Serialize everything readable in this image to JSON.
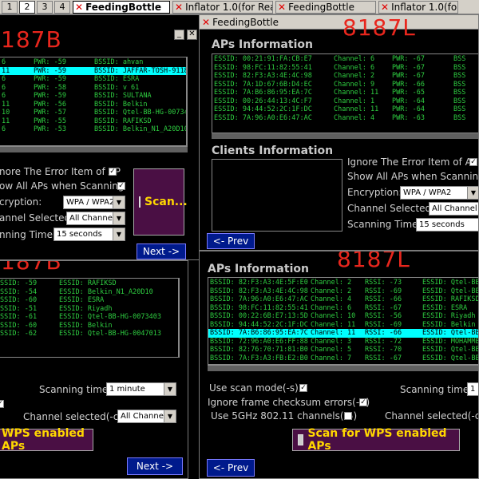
{
  "taskbar": {
    "workspaces": [
      "1",
      "2",
      "3",
      "4"
    ],
    "tasks": [
      "FeedingBottle",
      "Inflator 1.0(for Rea...",
      "FeedingBottle",
      "Inflator 1.0(for Rea..."
    ]
  },
  "win_tl": {
    "label": "187B",
    "rows": [
      {
        "essid": "6",
        "pwr": "PWR: -59",
        "bssid": "BSSID: ahvan"
      },
      {
        "essid": "11",
        "pwr": "PWR: -59",
        "bssid": "BSSID: JAFFAR-TOSH-91180"
      },
      {
        "essid": "6",
        "pwr": "PWR: -59",
        "bssid": "BSSID: ESRA"
      },
      {
        "essid": "6",
        "pwr": "PWR: -58",
        "bssid": "BSSID: v 61"
      },
      {
        "essid": "6",
        "pwr": "PWR: -59",
        "bssid": "BSSID: SULTANA"
      },
      {
        "essid": "11",
        "pwr": "PWR: -56",
        "bssid": "BSSID: Belkin"
      },
      {
        "essid": "10",
        "pwr": "PWR: -57",
        "bssid": "BSSID: Qtel-BB-HG-007340"
      },
      {
        "essid": "11",
        "pwr": "PWR: -55",
        "bssid": "BSSID: RAFIKSD"
      },
      {
        "essid": "6",
        "pwr": "PWR: -53",
        "bssid": "BSSID: Belkin_N1_A20D10"
      }
    ],
    "ignore_label": "nore The Error Item of AP",
    "show_label": "ow All APs when Scanning",
    "encryption_label": "cryption:",
    "encryption_value": "WPA / WPA2",
    "channel_label": "annel Selected:",
    "channel_value": "All Channel",
    "time_label": "nning Time:",
    "time_value": "15 seconds",
    "scan_label": "Scan...",
    "next_label": "Next ->"
  },
  "win_tr": {
    "title": "FeedingBottle",
    "label": "8187L",
    "aps_title": "APs Information",
    "rows": [
      {
        "essid": "ESSID: 00:21:91:FA:CB:E7",
        "channel": "Channel: 6",
        "pwr": "PWR: -67",
        "bssid": "BSS"
      },
      {
        "essid": "ESSID: 98:FC:11:82:55:41",
        "channel": "Channel: 6",
        "pwr": "PWR: -67",
        "bssid": "BSS"
      },
      {
        "essid": "ESSID: 82:F3:A3:4E:4C:98",
        "channel": "Channel: 2",
        "pwr": "PWR: -67",
        "bssid": "BSS"
      },
      {
        "essid": "ESSID: 7A:1D:67:6B:D4:EC",
        "channel": "Channel: 9",
        "pwr": "PWR: -66",
        "bssid": "BSS"
      },
      {
        "essid": "ESSID: 7A:B6:86:95:EA:7C",
        "channel": "Channel: 11",
        "pwr": "PWR: -65",
        "bssid": "BSS"
      },
      {
        "essid": "ESSID: 00:26:44:13:4C:F7",
        "channel": "Channel: 1",
        "pwr": "PWR: -64",
        "bssid": "BSS"
      },
      {
        "essid": "ESSID: 94:44:52:2C:1F:DC",
        "channel": "Channel: 11",
        "pwr": "PWR: -64",
        "bssid": "BSS"
      },
      {
        "essid": "ESSID: 7A:96:A0:E6:47:AC",
        "channel": "Channel: 4",
        "pwr": "PWR: -63",
        "bssid": "BSS"
      }
    ],
    "clients_title": "Clients Information",
    "ignore_label": "Ignore The Error Item of AP",
    "show_label": "Show All APs when Scanning",
    "encryption_label": "Encryption:",
    "encryption_value": "WPA / WPA2",
    "channel_label": "Channel Selected:",
    "channel_value": "All Channel",
    "time_label": "Scanning Time:",
    "time_value": "15 seconds",
    "prev_label": "<- Prev"
  },
  "win_bl": {
    "label": "187B",
    "rows": [
      {
        "rssi": "SSID: -59",
        "essid": "ESSID: RAFIKSD"
      },
      {
        "rssi": "SSID: -54",
        "essid": "ESSID: Belkin_N1_A20D10"
      },
      {
        "rssi": "SSID: -60",
        "essid": "ESSID: ESRA"
      },
      {
        "rssi": "SSID: -51",
        "essid": "ESSID: Riyadh"
      },
      {
        "rssi": "SSID: -61",
        "essid": "ESSID: Qtel-BB-HG-0073403"
      },
      {
        "rssi": "SSID: -60",
        "essid": "ESSID: Belkin"
      },
      {
        "rssi": "SSID: -62",
        "essid": "ESSID: Qtel-BB-HG-0047013"
      }
    ],
    "time_label": "Scanning time:",
    "time_value": "1 minute",
    "channel_label": "Channel selected(-c):",
    "channel_value": "All Channel",
    "wps_label": "WPS enabled APs",
    "next_label": "Next ->"
  },
  "win_br": {
    "label": "8187L",
    "aps_title": "APs Information",
    "rows": [
      {
        "bssid": "BSSID: 82:F3:A3:4E:5F:E0",
        "channel": "Channel: 2",
        "rssi": "RSSI: -73",
        "essid": "ESSID: Qtel-BB-H"
      },
      {
        "bssid": "BSSID: 82:F3:A3:4E:4C:98",
        "channel": "Channel: 2",
        "rssi": "RSSI: -69",
        "essid": "ESSID: Qtel-BB-H"
      },
      {
        "bssid": "BSSID: 7A:96:A0:E6:47:AC",
        "channel": "Channel: 4",
        "rssi": "RSSI: -66",
        "essid": "ESSID: RAFIKSD"
      },
      {
        "bssid": "BSSID: 98:FC:11:82:55:41",
        "channel": "Channel: 6",
        "rssi": "RSSI: -67",
        "essid": "ESSID: ESRA"
      },
      {
        "bssid": "BSSID: 00:22:6B:E7:13:5D",
        "channel": "Channel: 10",
        "rssi": "RSSI: -56",
        "essid": "ESSID: Riyadh"
      },
      {
        "bssid": "BSSID: 94:44:52:2C:1F:DC",
        "channel": "Channel: 11",
        "rssi": "RSSI: -69",
        "essid": "ESSID: Belkin"
      },
      {
        "bssid": "BSSID: 7A:B6:86:95:EA:7C",
        "channel": "Channel: 11",
        "rssi": "RSSI: -66",
        "essid": "ESSID: Qtel-BB-H"
      },
      {
        "bssid": "BSSID: 72:96:A0:E6:FF:88",
        "channel": "Channel: 3",
        "rssi": "RSSI: -72",
        "essid": "ESSID: MOHAMMED"
      },
      {
        "bssid": "BSSID: 82:76:70:71:81:B0",
        "channel": "Channel: 5",
        "rssi": "RSSI: -70",
        "essid": "ESSID: Qtel-BB-H"
      },
      {
        "bssid": "BSSID: 7A:F3:A3:FB:E2:B0",
        "channel": "Channel: 7",
        "rssi": "RSSI: -67",
        "essid": "ESSID: Qtel-BB-H"
      }
    ],
    "scan_mode_label": "Use scan mode(-s)",
    "ignore_frame_label": "Ignore frame checksum errors(-C)",
    "use_5ghz_label": "Use 5GHz 802.11 channels(-5)",
    "time_label": "Scanning time:",
    "time_value": "1 m",
    "channel_label": "Channel selected(-c):",
    "wps_label": "Scan for WPS enabled APs",
    "prev_label": "<- Prev"
  }
}
